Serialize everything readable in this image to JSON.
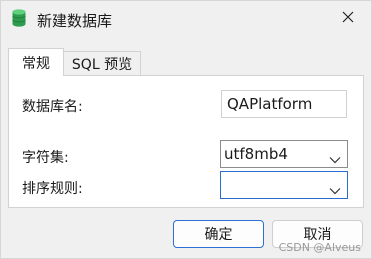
{
  "window": {
    "title": "新建数据库",
    "icon": "database-icon",
    "close_icon": "close-icon"
  },
  "tabs": [
    {
      "label": "常规",
      "active": true
    },
    {
      "label": "SQL 预览",
      "active": false
    }
  ],
  "form": {
    "db_name_label": "数据库名:",
    "db_name_value": "QAPlatform",
    "charset_label": "字符集:",
    "charset_value": "utf8mb4",
    "collation_label": "排序规则:",
    "collation_value": ""
  },
  "buttons": {
    "ok": "确定",
    "cancel": "取消"
  },
  "watermark": "CSDN @Alveus",
  "colors": {
    "accent": "#2f6fd0",
    "db_icon": "#2e9b4f"
  }
}
